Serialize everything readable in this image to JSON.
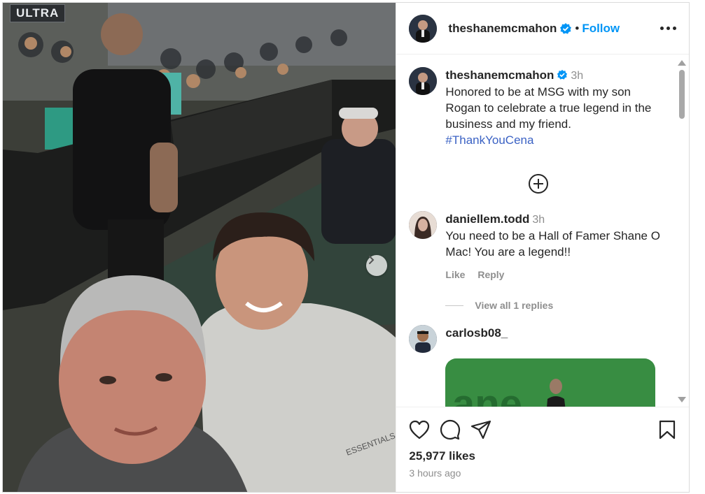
{
  "media": {
    "sign_text": "ULTRA"
  },
  "post": {
    "username": "theshanemcmahon",
    "dot": "•",
    "follow_label": "Follow",
    "caption": {
      "username": "theshanemcmahon",
      "time": "3h",
      "text": "Honored to be at MSG with my son Rogan to celebrate a true legend in the business and my friend.",
      "hashtag": "#ThankYouCena"
    },
    "comments": [
      {
        "username": "daniellem.todd",
        "time": "3h",
        "text": "You need to be a Hall of Famer Shane O Mac! You are a legend!!",
        "like_label": "Like",
        "reply_label": "Reply",
        "view_replies": "View all 1 replies"
      },
      {
        "username": "carlosb08_"
      }
    ],
    "likes": "25,977 likes",
    "time_ago": "3 hours ago"
  },
  "icons": {
    "header_more": "more-options-icon",
    "add_comments": "plus-circle-icon",
    "like": "heart-icon",
    "comment": "comment-icon",
    "share": "share-icon",
    "save": "bookmark-icon",
    "carousel_next": "chevron-right-icon",
    "verified": "verified-badge-icon"
  },
  "colors": {
    "accent": "#0095f6",
    "verified": "#0095f6",
    "hashtag": "#3b62c4",
    "muted": "#8e8e8e"
  }
}
